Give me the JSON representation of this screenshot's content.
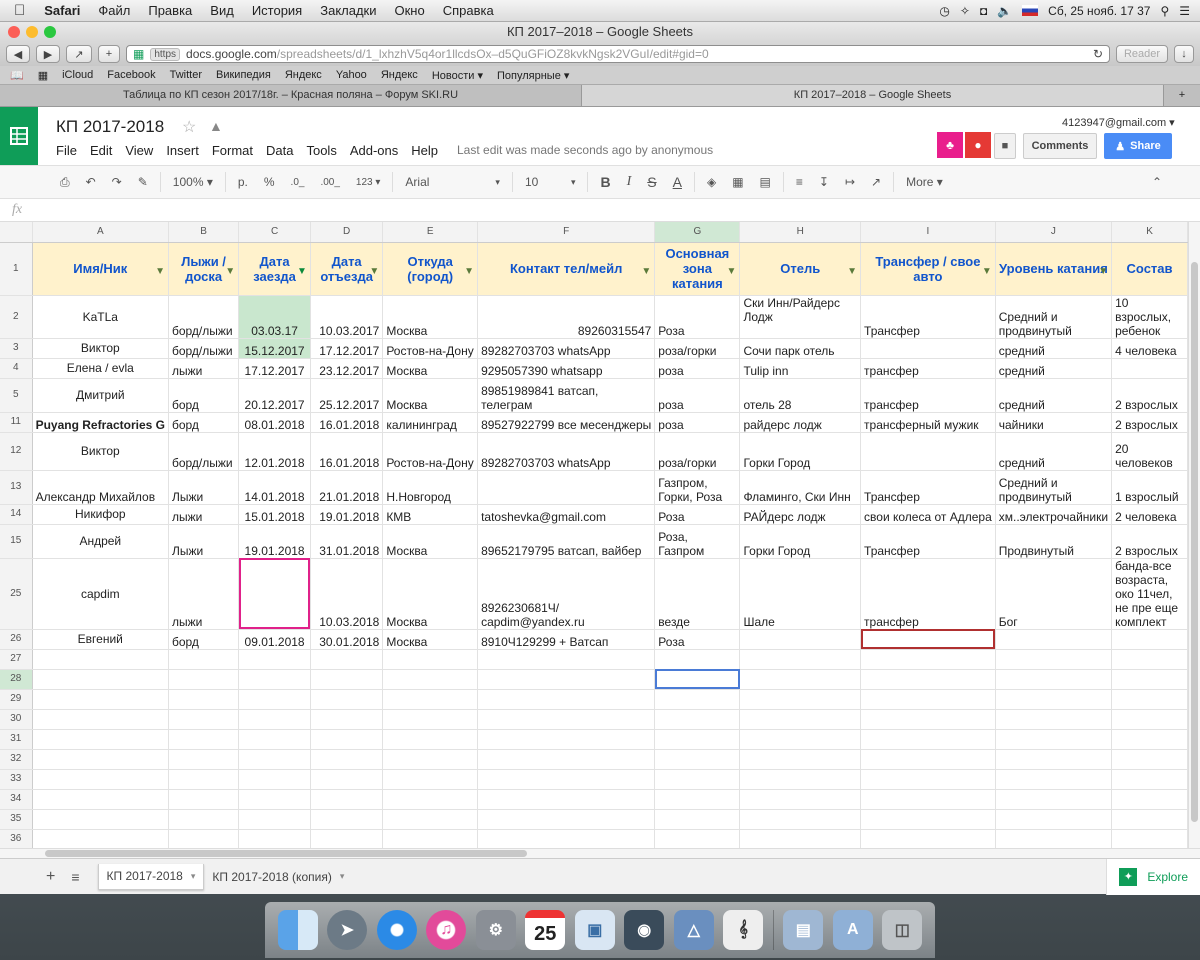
{
  "mac_menubar": {
    "apple_icon": "apple-icon",
    "items": [
      "Safari",
      "Файл",
      "Правка",
      "Вид",
      "История",
      "Закладки",
      "Окно",
      "Справка"
    ],
    "clock_text": "Сб, 25 нояб. 17 37"
  },
  "safari": {
    "window_title": "КП 2017–2018 – Google Sheets",
    "url_scheme": "https",
    "url_domain": "docs.google.com",
    "url_path": "/spreadsheets/d/1_lxhzhV5q4or1llcdsOx–d5QuGFiOZ8kvkNgsk2VGuI/edit#gid=0",
    "reader_label": "Reader",
    "bookmarks": [
      "iCloud",
      "Facebook",
      "Twitter",
      "Википедия",
      "Яндекс",
      "Yahoo",
      "Яндекс",
      "Новости ▾",
      "Популярные ▾"
    ],
    "tabs": [
      {
        "label": "Таблица по КП сезон 2017/18г. – Красная поляна – Форум SKI.RU",
        "active": false
      },
      {
        "label": "КП 2017–2018 – Google Sheets",
        "active": true
      }
    ]
  },
  "sheets": {
    "title": "КП 2017-2018",
    "menus": [
      "File",
      "Edit",
      "View",
      "Insert",
      "Format",
      "Data",
      "Tools",
      "Add-ons",
      "Help"
    ],
    "last_edit": "Last edit was made seconds ago by anonymous",
    "account": "4123947@gmail.com",
    "comments_label": "Comments",
    "share_label": "Share",
    "toolbar": {
      "zoom": "100%",
      "currency": "р.",
      "percent": "%",
      "dec_less": ".0_",
      "dec_more": ".00_",
      "num_format": "123",
      "font": "Arial",
      "font_size": "10",
      "bold": "B",
      "italic": "I",
      "strike": "S",
      "text_color": "A",
      "more": "More"
    },
    "fx_label": "fx",
    "columns": [
      "A",
      "B",
      "C",
      "D",
      "E",
      "F",
      "G",
      "H",
      "I",
      "J",
      "K"
    ],
    "headers": [
      "Имя/Ник",
      "Лыжи / доска",
      "Дата заезда",
      "Дата отъезда",
      "Откуда (город)",
      "Контакт тел/мейл",
      "Основная зона катания",
      "Отель",
      "Трансфер / свое авто",
      "Уровень катания",
      "Состав"
    ],
    "rows": [
      {
        "num": "2",
        "cells": [
          "KaTLa",
          "борд/лыжи",
          "03.03.17",
          "10.03.2017",
          "Москва",
          "89260315547",
          "Роза",
          "Ски Инн/Райдерс Лодж",
          "Трансфер",
          "Средний и продвинутый",
          "10 взрослых, ребенок"
        ]
      },
      {
        "num": "3",
        "cells": [
          "Виктор",
          "борд/лыжи",
          "15.12.2017",
          "17.12.2017",
          "Ростов-на-Дону",
          "89282703703 whatsApp",
          "роза/горки",
          "Сочи парк отель",
          "",
          "средний",
          "4 человека"
        ]
      },
      {
        "num": "4",
        "cells": [
          "Елена / evla",
          "лыжи",
          "17.12.2017",
          "23.12.2017",
          "Москва",
          "9295057390 whatsapp",
          "роза",
          "Tulip inn",
          "трансфер",
          "средний",
          ""
        ]
      },
      {
        "num": "5",
        "cells": [
          "Дмитрий",
          "борд",
          "20.12.2017",
          "25.12.2017",
          "Москва",
          "89851989841 ватсап, телеграм",
          "роза",
          "отель 28",
          "трансфер",
          "средний",
          "2 взрослых"
        ]
      },
      {
        "num": "11",
        "cells": [
          "Puyang Refractories G",
          "борд",
          "08.01.2018",
          "16.01.2018",
          "калининград",
          "89527922799 все месенджеры",
          "роза",
          "райдерс лодж",
          "трансферный мужик",
          "чайники",
          "2 взрослых"
        ]
      },
      {
        "num": "12",
        "cells": [
          "Виктор",
          "борд/лыжи",
          "12.01.2018",
          "16.01.2018",
          "Ростов-на-Дону",
          "89282703703 whatsApp",
          "роза/горки",
          "Горки Город",
          "",
          "средний",
          "20 человеков"
        ]
      },
      {
        "num": "13",
        "cells": [
          "Александр Михайлов",
          "Лыжи",
          "14.01.2018",
          "21.01.2018",
          "Н.Новгород",
          "",
          "Газпром, Горки, Роза",
          "Фламинго, Ски Инн",
          "Трансфер",
          "Средний и продвинутый",
          "1 взрослый"
        ]
      },
      {
        "num": "14",
        "cells": [
          "Никифор",
          "лыжи",
          "15.01.2018",
          "19.01.2018",
          "КМВ",
          "tatoshevka@gmail.com",
          "Роза",
          "РАЙдерс лодж",
          "свои колеса от Адлера",
          "хм..электрочайники",
          "2 человека"
        ]
      },
      {
        "num": "15",
        "cells": [
          "Андрей",
          "Лыжи",
          "19.01.2018",
          "31.01.2018",
          "Москва",
          "89652179795 ватсап, вайбер",
          "Роза, Газпром",
          "Горки Город",
          "Трансфер",
          "Продвинутый",
          "2 взрослых"
        ]
      },
      {
        "num": "25",
        "cells": [
          "capdim",
          "лыжи",
          "",
          "10.03.2018",
          "Москва",
          "8926230681Ч/ capdim@yandex.ru",
          "везде",
          "Шале",
          "трансфер",
          "Бог",
          "банда-все возраста, око 11чел, не пре еще комплект"
        ]
      },
      {
        "num": "26",
        "cells": [
          "Евгений",
          "борд",
          "09.01.2018",
          "30.01.2018",
          "Москва",
          "8910Ч129299 + Ватсап",
          "Роза",
          "",
          "",
          "",
          ""
        ]
      }
    ],
    "empty_rows": [
      "27",
      "28",
      "29",
      "30",
      "31",
      "32",
      "33",
      "34",
      "35",
      "36"
    ],
    "sheet_tabs": [
      {
        "label": "КП 2017-2018",
        "active": true
      },
      {
        "label": "КП 2017-2018 (копия)",
        "active": false
      }
    ],
    "explore_label": "Explore"
  }
}
